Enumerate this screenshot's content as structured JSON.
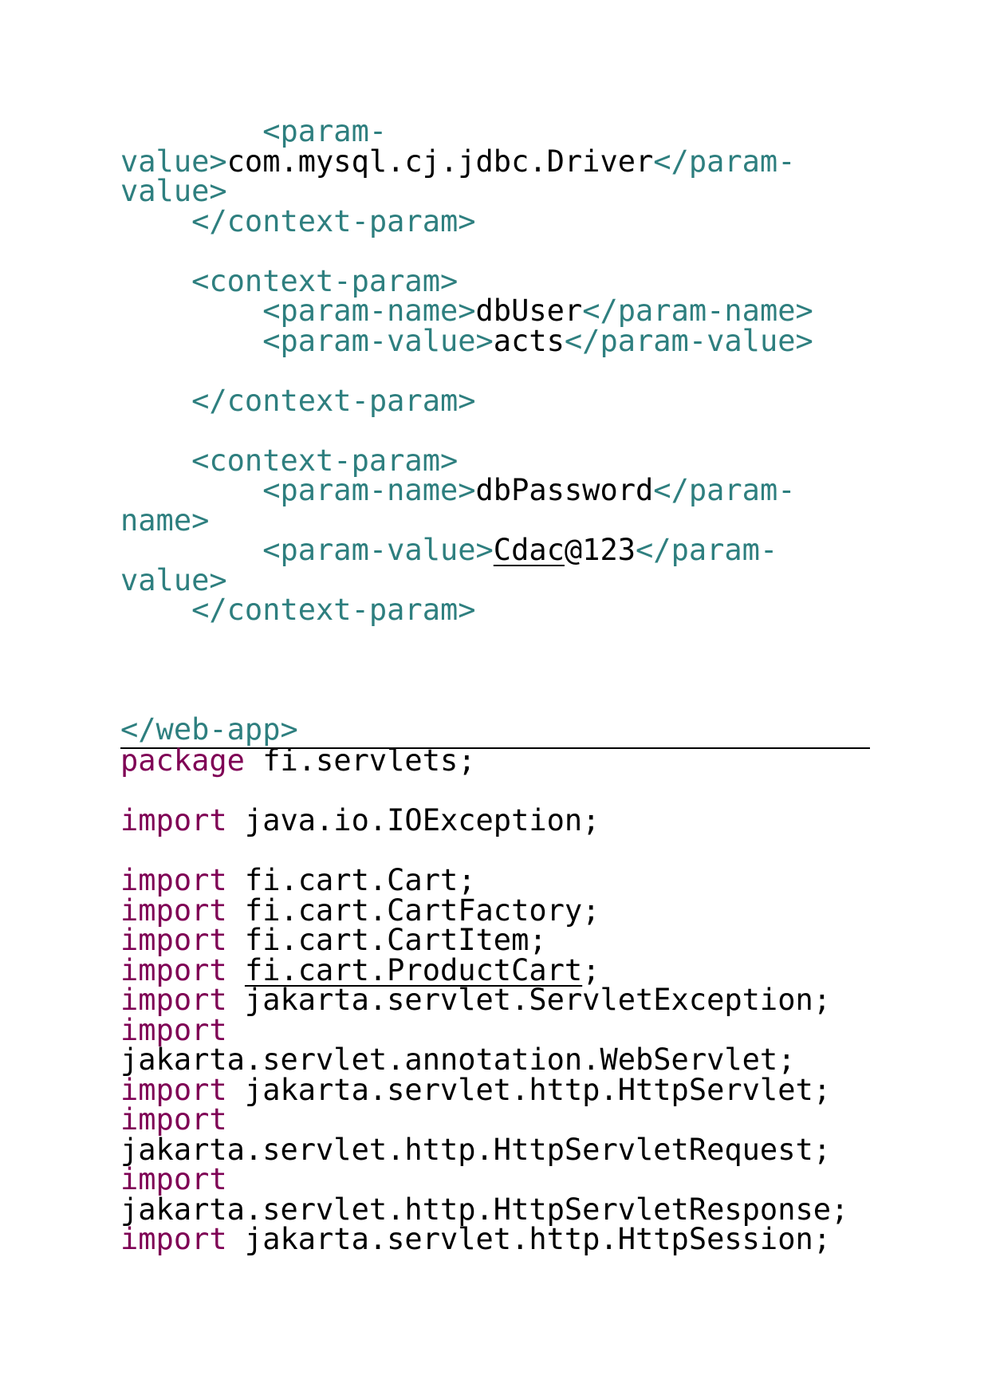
{
  "xml_lines": [
    [
      {
        "t": "        <param-",
        "c": "tag"
      }
    ],
    [
      {
        "t": "value>",
        "c": "tag"
      },
      {
        "t": "com.mysql.cj.jdbc.Driver",
        "c": "txt"
      },
      {
        "t": "</param-",
        "c": "tag"
      }
    ],
    [
      {
        "t": "value>",
        "c": "tag"
      }
    ],
    [
      {
        "t": "    </context-param>",
        "c": "tag"
      }
    ],
    [],
    [
      {
        "t": "    <context-param>",
        "c": "tag"
      }
    ],
    [
      {
        "t": "        <param-name>",
        "c": "tag"
      },
      {
        "t": "dbUser",
        "c": "txt"
      },
      {
        "t": "</param-name>",
        "c": "tag"
      }
    ],
    [
      {
        "t": "        <param-value>",
        "c": "tag"
      },
      {
        "t": "acts",
        "c": "txt"
      },
      {
        "t": "</param-value>",
        "c": "tag"
      }
    ],
    [],
    [
      {
        "t": "    </context-param>",
        "c": "tag"
      }
    ],
    [],
    [
      {
        "t": "    <context-param>",
        "c": "tag"
      }
    ],
    [
      {
        "t": "        <param-name>",
        "c": "tag"
      },
      {
        "t": "dbPassword",
        "c": "txt"
      },
      {
        "t": "</param-",
        "c": "tag"
      }
    ],
    [
      {
        "t": "name>",
        "c": "tag"
      }
    ],
    [
      {
        "t": "        <param-value>",
        "c": "tag"
      },
      {
        "t": "Cdac",
        "c": "txt ul"
      },
      {
        "t": "@123",
        "c": "txt"
      },
      {
        "t": "</param-",
        "c": "tag"
      }
    ],
    [
      {
        "t": "value>",
        "c": "tag"
      }
    ],
    [
      {
        "t": "    </context-param>",
        "c": "tag"
      }
    ],
    [],
    [],
    [],
    [
      {
        "t": "</web-app>",
        "c": "tag"
      }
    ]
  ],
  "java_lines": [
    [
      {
        "t": "package",
        "c": "kw"
      },
      {
        "t": " fi.servlets;",
        "c": "txt"
      }
    ],
    [],
    [
      {
        "t": "import",
        "c": "kw"
      },
      {
        "t": " java.io.IOException;",
        "c": "txt"
      }
    ],
    [],
    [
      {
        "t": "import",
        "c": "kw"
      },
      {
        "t": " fi.cart.Cart;",
        "c": "txt"
      }
    ],
    [
      {
        "t": "import",
        "c": "kw"
      },
      {
        "t": " fi.cart.CartFactory;",
        "c": "txt"
      }
    ],
    [
      {
        "t": "import",
        "c": "kw"
      },
      {
        "t": " fi.cart.CartItem;",
        "c": "txt"
      }
    ],
    [
      {
        "t": "import",
        "c": "kw"
      },
      {
        "t": " ",
        "c": "txt"
      },
      {
        "t": "fi.cart.ProductCart",
        "c": "txt ul"
      },
      {
        "t": ";",
        "c": "txt"
      }
    ],
    [
      {
        "t": "import",
        "c": "kw"
      },
      {
        "t": " jakarta.servlet.ServletException;",
        "c": "txt"
      }
    ],
    [
      {
        "t": "import",
        "c": "kw"
      }
    ],
    [
      {
        "t": "jakarta.servlet.annotation.WebServlet;",
        "c": "txt"
      }
    ],
    [
      {
        "t": "import",
        "c": "kw"
      },
      {
        "t": " jakarta.servlet.http.HttpServlet;",
        "c": "txt"
      }
    ],
    [
      {
        "t": "import",
        "c": "kw"
      }
    ],
    [
      {
        "t": "jakarta.servlet.http.HttpServletRequest;",
        "c": "txt"
      }
    ],
    [
      {
        "t": "import",
        "c": "kw"
      }
    ],
    [
      {
        "t": "jakarta.servlet.http.HttpServletResponse;",
        "c": "txt"
      }
    ],
    [
      {
        "t": "import",
        "c": "kw"
      },
      {
        "t": " jakarta.servlet.http.HttpSession;",
        "c": "txt"
      }
    ]
  ]
}
